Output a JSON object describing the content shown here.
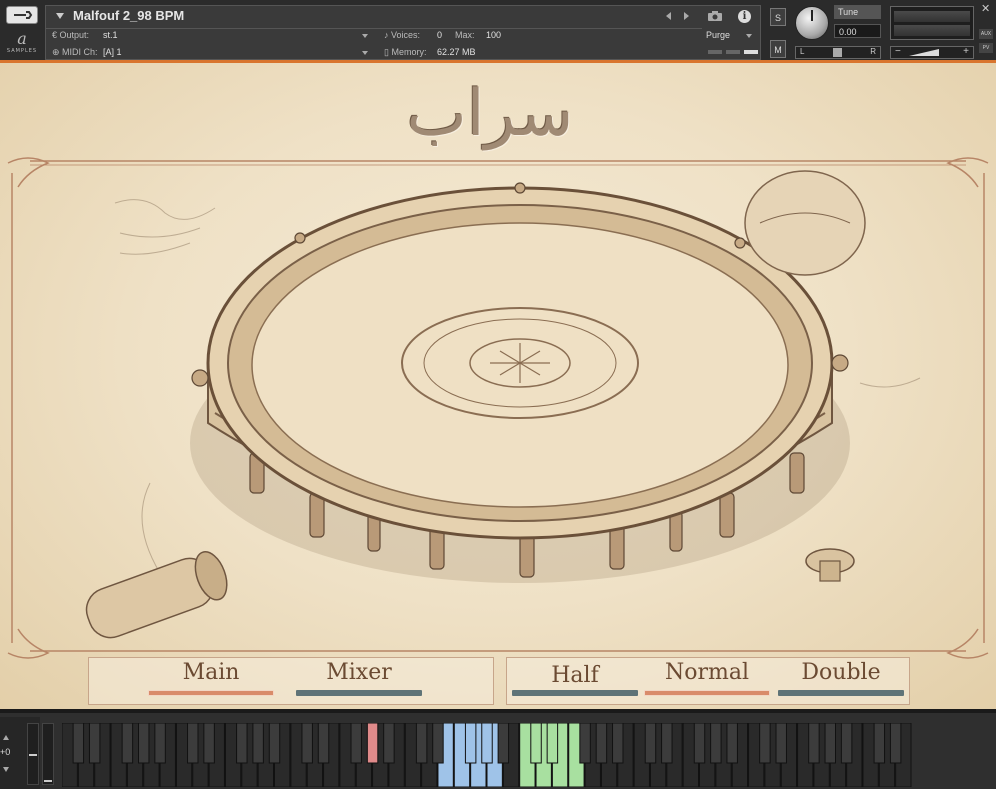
{
  "header": {
    "instrument_name": "Malfouf 2_98 BPM",
    "output_label": "Output:",
    "output_value": "st.1",
    "midi_label": "MIDI Ch:",
    "midi_value": "[A]  1",
    "voices_label": "Voices:",
    "voices_value": "0",
    "max_label": "Max:",
    "max_value": "100",
    "memory_label": "Memory:",
    "memory_value": "62.27 MB",
    "purge_label": "Purge",
    "solo_label": "S",
    "mute_label": "M",
    "tune_label": "Tune",
    "tune_value": "0.00",
    "pan_left": "L",
    "pan_right": "R",
    "vol_minus": "−",
    "vol_plus": "+",
    "close": "✕",
    "aux_label": "AUX",
    "pv_label": "PV",
    "logo_text": "SAMPLES"
  },
  "art": {
    "title": "سراب"
  },
  "tabs": {
    "main": "Main",
    "mixer": "Mixer",
    "half": "Half",
    "normal": "Normal",
    "double": "Double"
  },
  "keyboard": {
    "octave": "+0",
    "white_key_count": 52,
    "highlight_colors": {
      "red": "#e08a8a",
      "blue": "#9fc3e8",
      "green": "#a8e0a0"
    }
  },
  "colors": {
    "accent_orange": "#d9752e",
    "tab_active": "#d98b6a",
    "tab_inactive": "#5f7377"
  }
}
